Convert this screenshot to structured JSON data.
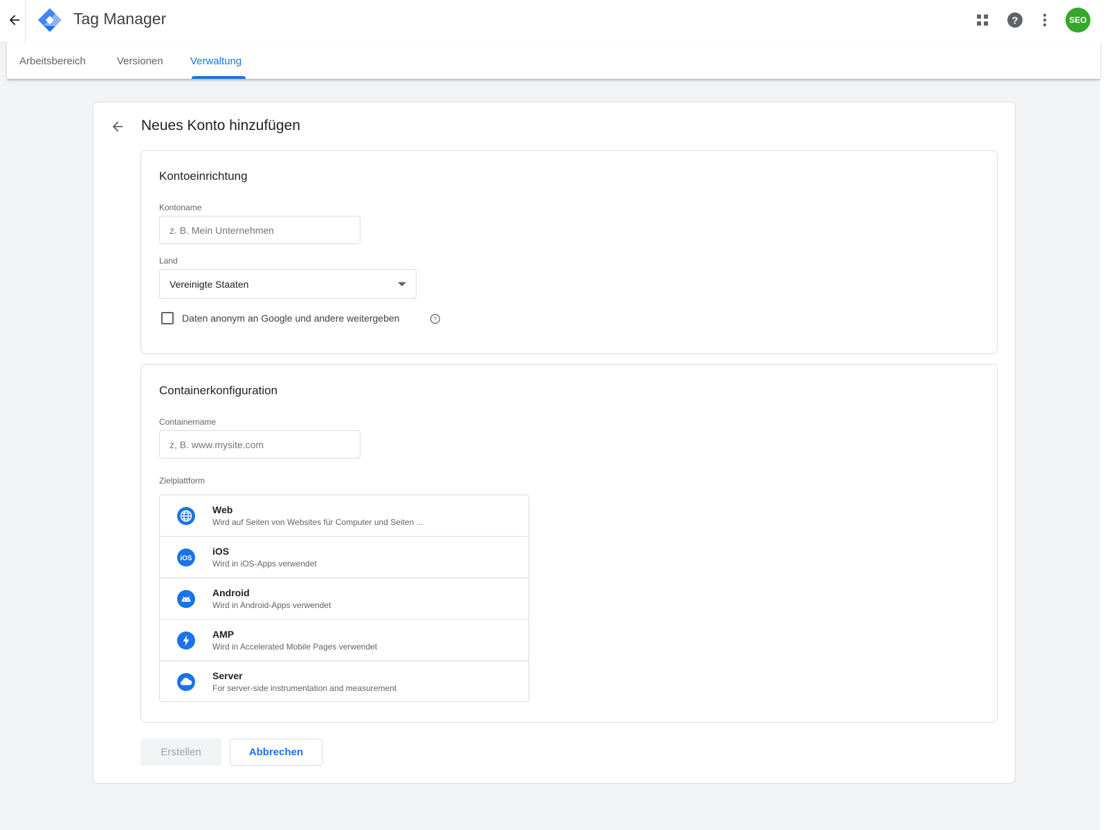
{
  "app": {
    "title": "Tag Manager",
    "avatar_text": "SEO"
  },
  "nav": {
    "tabs": [
      {
        "label": "Arbeitsbereich"
      },
      {
        "label": "Versionen"
      },
      {
        "label": "Verwaltung"
      }
    ],
    "active_tab": "Verwaltung"
  },
  "page": {
    "title": "Neues Konto hinzufügen"
  },
  "account_setup": {
    "title": "Kontoeinrichtung",
    "account_name_label": "Kontoname",
    "account_name_placeholder": "z. B. Mein Unternehmen",
    "country_label": "Land",
    "country_value": "Vereinigte Staaten",
    "share_data_label": "Daten anonym an Google und andere weitergeben",
    "share_data_checked": false
  },
  "container_setup": {
    "title": "Containerkonfiguration",
    "container_name_label": "Containername",
    "container_name_placeholder": "z, B. www.mysite.com",
    "platform_label": "Zielplattform",
    "platforms": [
      {
        "title": "Web",
        "desc": "Wird auf Seiten von Websites für Computer und Seiten ...",
        "icon": "globe-icon"
      },
      {
        "title": "iOS",
        "desc": "Wird in iOS-Apps verwendet",
        "icon": "ios-icon"
      },
      {
        "title": "Android",
        "desc": "Wird in Android-Apps verwendet",
        "icon": "android-icon"
      },
      {
        "title": "AMP",
        "desc": "Wird in Accelerated Mobile Pages verwendet",
        "icon": "amp-bolt-icon"
      },
      {
        "title": "Server",
        "desc": "For server-side instrumentation and measurement",
        "icon": "cloud-icon"
      }
    ]
  },
  "actions": {
    "create_label": "Erstellen",
    "cancel_label": "Abbrechen"
  },
  "colors": {
    "accent": "#1a73e8",
    "avatar": "#34a828",
    "page_bg": "#f1f3f4"
  }
}
